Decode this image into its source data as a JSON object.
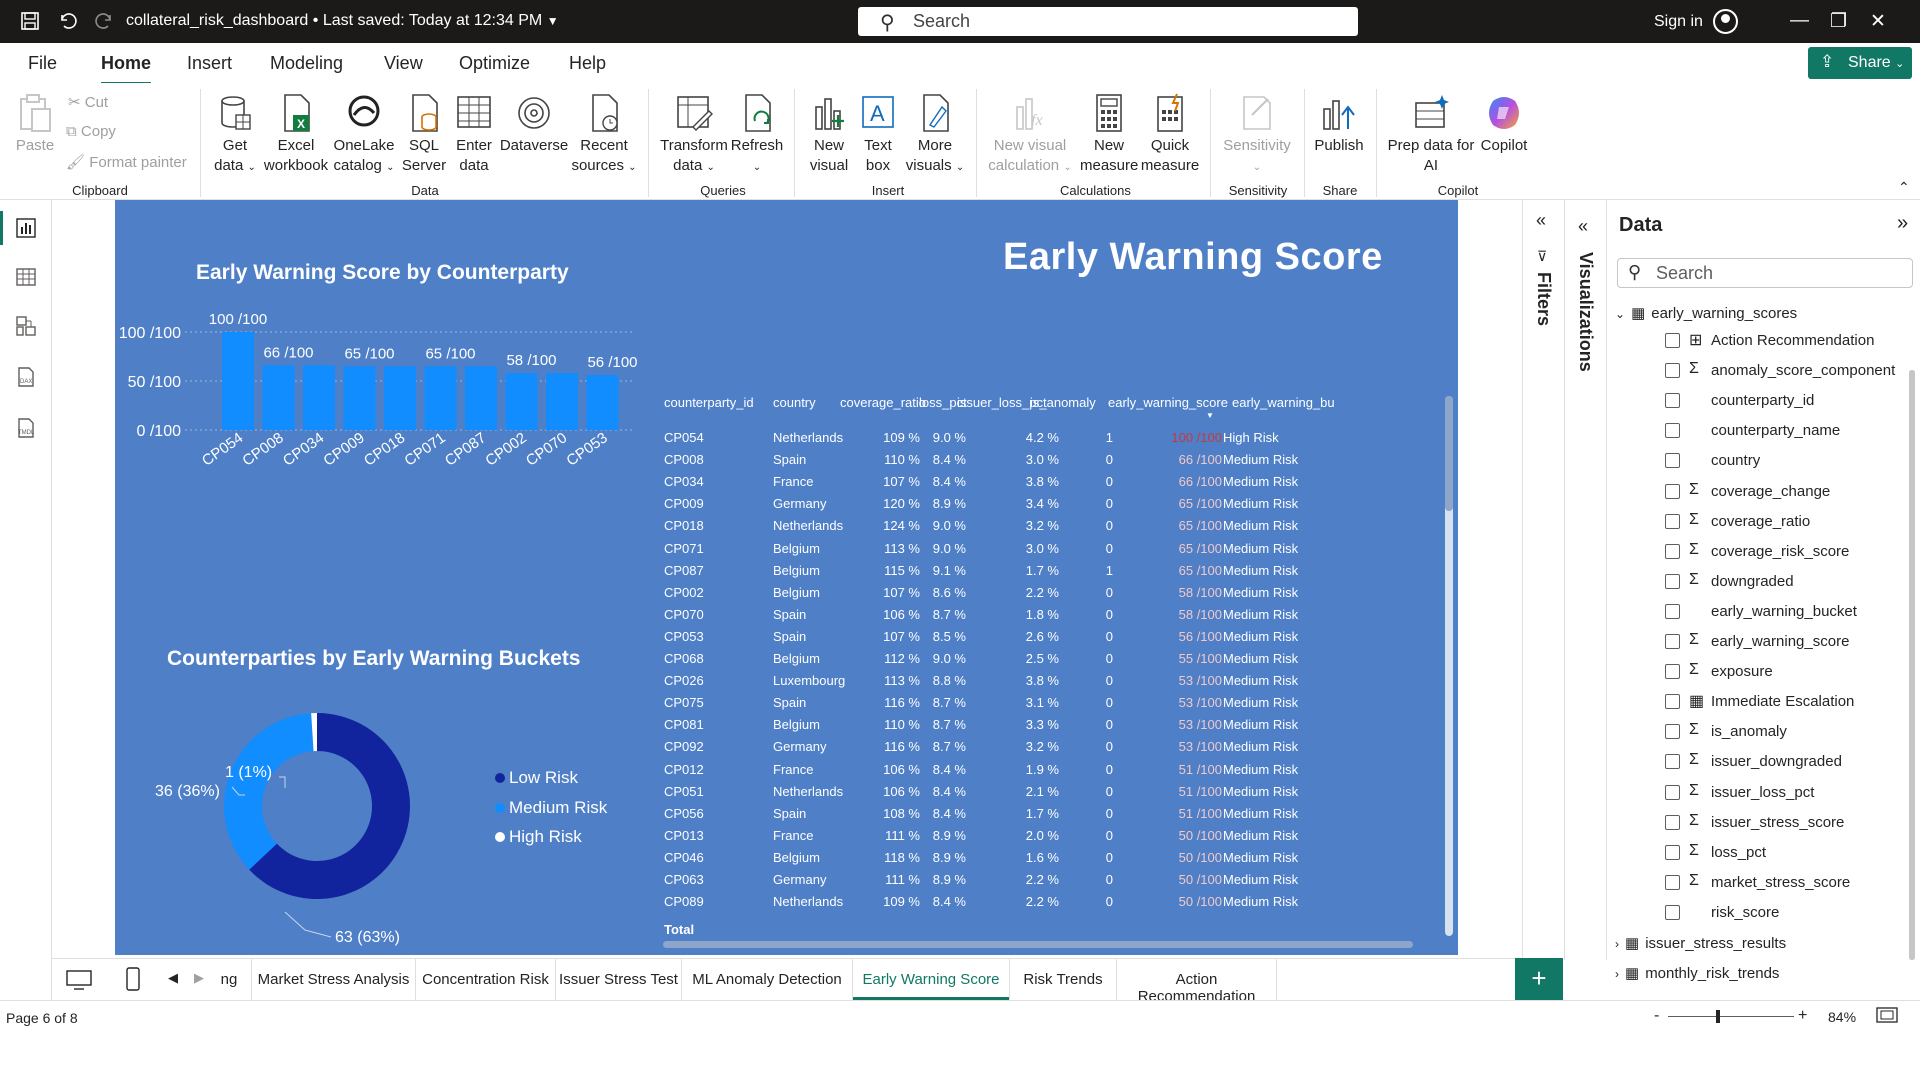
{
  "titlebar": {
    "file_title": "collateral_risk_dashboard",
    "saved": "• Last saved: Today at 12:34 PM",
    "search_placeholder": "Search",
    "signin": "Sign in"
  },
  "menu": {
    "items": [
      "File",
      "Home",
      "Insert",
      "Modeling",
      "View",
      "Optimize",
      "Help"
    ],
    "active": "Home",
    "share": "Share"
  },
  "ribbon": {
    "clipboard": {
      "paste": "Paste",
      "cut": "Cut",
      "copy": "Copy",
      "format_painter": "Format painter",
      "group": "Clipboard"
    },
    "data": {
      "get_data": "Get data",
      "excel": "Excel workbook",
      "onelake": "OneLake catalog",
      "sql": "SQL Server",
      "enter": "Enter data",
      "dataverse": "Dataverse",
      "recent": "Recent sources",
      "group": "Data"
    },
    "queries": {
      "transform": "Transform data",
      "refresh": "Refresh",
      "group": "Queries"
    },
    "insert": {
      "new_visual": "New visual",
      "text_box": "Text box",
      "more_visuals": "More visuals",
      "group": "Insert"
    },
    "calculations": {
      "new_visual_calc": "New visual calculation",
      "new_measure": "New measure",
      "quick_measure": "Quick measure",
      "group": "Calculations"
    },
    "sensitivity": {
      "label": "Sensitivity",
      "group": "Sensitivity"
    },
    "share": {
      "publish": "Publish",
      "group": "Share"
    },
    "copilot": {
      "prep": "Prep data for AI",
      "copilot": "Copilot",
      "group": "Copilot"
    }
  },
  "report": {
    "page_title": "Early Warning Score",
    "bar_title": "Early Warning Score by Counterparty",
    "donut_title": "Counterparties by Early Warning Buckets"
  },
  "chart_data": [
    {
      "type": "bar",
      "title": "Early Warning Score by Counterparty",
      "categories": [
        "CP054",
        "CP008",
        "CP034",
        "CP009",
        "CP018",
        "CP071",
        "CP087",
        "CP002",
        "CP070",
        "CP053"
      ],
      "values": [
        100,
        66,
        66,
        65,
        65,
        65,
        65,
        58,
        58,
        56
      ],
      "data_labels": [
        "100 /100",
        "66 /100",
        "",
        "65 /100",
        "",
        "65 /100",
        "",
        "58 /100",
        "",
        "56 /100"
      ],
      "yticks": [
        "0 /100",
        "50 /100",
        "100 /100"
      ],
      "ylim": [
        0,
        100
      ],
      "color": "#118dff"
    },
    {
      "type": "pie",
      "title": "Counterparties by Early Warning Buckets",
      "slices": [
        {
          "name": "Low Risk",
          "value": 63,
          "label": "63 (63%)",
          "color": "#12239e"
        },
        {
          "name": "Medium Risk",
          "value": 36,
          "label": "36 (36%)",
          "color": "#118dff"
        },
        {
          "name": "High Risk",
          "value": 1,
          "label": "1 (1%)",
          "color": "#ffffff"
        }
      ]
    }
  ],
  "table": {
    "headers": [
      "counterparty_id",
      "country",
      "coverage_ratio",
      "loss_pct",
      "issuer_loss_pct",
      "is_anomaly",
      "early_warning_score",
      "early_warning_bu"
    ],
    "rows": [
      [
        "CP054",
        "Netherlands",
        "109 %",
        "9.0 %",
        "4.2 %",
        "1",
        "100 /100",
        "High Risk"
      ],
      [
        "CP008",
        "Spain",
        "110 %",
        "8.4 %",
        "3.0 %",
        "0",
        "66 /100",
        "Medium Risk"
      ],
      [
        "CP034",
        "France",
        "107 %",
        "8.4 %",
        "3.8 %",
        "0",
        "66 /100",
        "Medium Risk"
      ],
      [
        "CP009",
        "Germany",
        "120 %",
        "8.9 %",
        "3.4 %",
        "0",
        "65 /100",
        "Medium Risk"
      ],
      [
        "CP018",
        "Netherlands",
        "124 %",
        "9.0 %",
        "3.2 %",
        "0",
        "65 /100",
        "Medium Risk"
      ],
      [
        "CP071",
        "Belgium",
        "113 %",
        "9.0 %",
        "3.0 %",
        "0",
        "65 /100",
        "Medium Risk"
      ],
      [
        "CP087",
        "Belgium",
        "115 %",
        "9.1 %",
        "1.7 %",
        "1",
        "65 /100",
        "Medium Risk"
      ],
      [
        "CP002",
        "Belgium",
        "107 %",
        "8.6 %",
        "2.2 %",
        "0",
        "58 /100",
        "Medium Risk"
      ],
      [
        "CP070",
        "Spain",
        "106 %",
        "8.7 %",
        "1.8 %",
        "0",
        "58 /100",
        "Medium Risk"
      ],
      [
        "CP053",
        "Spain",
        "107 %",
        "8.5 %",
        "2.6 %",
        "0",
        "56 /100",
        "Medium Risk"
      ],
      [
        "CP068",
        "Belgium",
        "112 %",
        "9.0 %",
        "2.5 %",
        "0",
        "55 /100",
        "Medium Risk"
      ],
      [
        "CP026",
        "Luxembourg",
        "113 %",
        "8.8 %",
        "3.8 %",
        "0",
        "53 /100",
        "Medium Risk"
      ],
      [
        "CP075",
        "Spain",
        "116 %",
        "8.7 %",
        "3.1 %",
        "0",
        "53 /100",
        "Medium Risk"
      ],
      [
        "CP081",
        "Belgium",
        "110 %",
        "8.7 %",
        "3.3 %",
        "0",
        "53 /100",
        "Medium Risk"
      ],
      [
        "CP092",
        "Germany",
        "116 %",
        "8.7 %",
        "3.2 %",
        "0",
        "53 /100",
        "Medium Risk"
      ],
      [
        "CP012",
        "France",
        "106 %",
        "8.4 %",
        "1.9 %",
        "0",
        "51 /100",
        "Medium Risk"
      ],
      [
        "CP051",
        "Netherlands",
        "106 %",
        "8.4 %",
        "2.1 %",
        "0",
        "51 /100",
        "Medium Risk"
      ],
      [
        "CP056",
        "Spain",
        "108 %",
        "8.4 %",
        "1.7 %",
        "0",
        "51 /100",
        "Medium Risk"
      ],
      [
        "CP013",
        "France",
        "111 %",
        "8.9 %",
        "2.0 %",
        "0",
        "50 /100",
        "Medium Risk"
      ],
      [
        "CP046",
        "Belgium",
        "118 %",
        "8.9 %",
        "1.6 %",
        "0",
        "50 /100",
        "Medium Risk"
      ],
      [
        "CP063",
        "Germany",
        "111 %",
        "8.9 %",
        "2.2 %",
        "0",
        "50 /100",
        "Medium Risk"
      ],
      [
        "CP089",
        "Netherlands",
        "109 %",
        "8.4 %",
        "2.2 %",
        "0",
        "50 /100",
        "Medium Risk"
      ]
    ],
    "total_label": "Total"
  },
  "panes": {
    "filters": "Filters",
    "visualizations": "Visualizations",
    "data_title": "Data",
    "search_placeholder": "Search"
  },
  "fields": {
    "tables": [
      "early_warning_scores",
      "issuer_stress_results",
      "monthly_risk_trends"
    ],
    "items": [
      {
        "name": "Action Recommendation",
        "icon": "calc-column-icon"
      },
      {
        "name": "anomaly_score_component",
        "icon": "sigma-icon"
      },
      {
        "name": "counterparty_id",
        "icon": ""
      },
      {
        "name": "counterparty_name",
        "icon": ""
      },
      {
        "name": "country",
        "icon": ""
      },
      {
        "name": "coverage_change",
        "icon": "sigma-icon"
      },
      {
        "name": "coverage_ratio",
        "icon": "sigma-icon"
      },
      {
        "name": "coverage_risk_score",
        "icon": "sigma-icon"
      },
      {
        "name": "downgraded",
        "icon": "sigma-icon"
      },
      {
        "name": "early_warning_bucket",
        "icon": ""
      },
      {
        "name": "early_warning_score",
        "icon": "sigma-icon"
      },
      {
        "name": "exposure",
        "icon": "sigma-icon"
      },
      {
        "name": "Immediate Escalation",
        "icon": "calc-table-icon"
      },
      {
        "name": "is_anomaly",
        "icon": "sigma-icon"
      },
      {
        "name": "issuer_downgraded",
        "icon": "sigma-icon"
      },
      {
        "name": "issuer_loss_pct",
        "icon": "sigma-icon"
      },
      {
        "name": "issuer_stress_score",
        "icon": "sigma-icon"
      },
      {
        "name": "loss_pct",
        "icon": "sigma-icon"
      },
      {
        "name": "market_stress_score",
        "icon": "sigma-icon"
      },
      {
        "name": "risk_score",
        "icon": ""
      }
    ]
  },
  "tabs": {
    "items": [
      "ng",
      "Market Stress Analysis",
      "Concentration Risk",
      "Issuer Stress Test",
      "ML Anomaly Detection",
      "Early Warning Score",
      "Risk Trends",
      "Action Recommendation"
    ],
    "active": "Early Warning Score",
    "add": "+"
  },
  "status": {
    "page": "Page 6 of 8",
    "zoom": "84%"
  }
}
